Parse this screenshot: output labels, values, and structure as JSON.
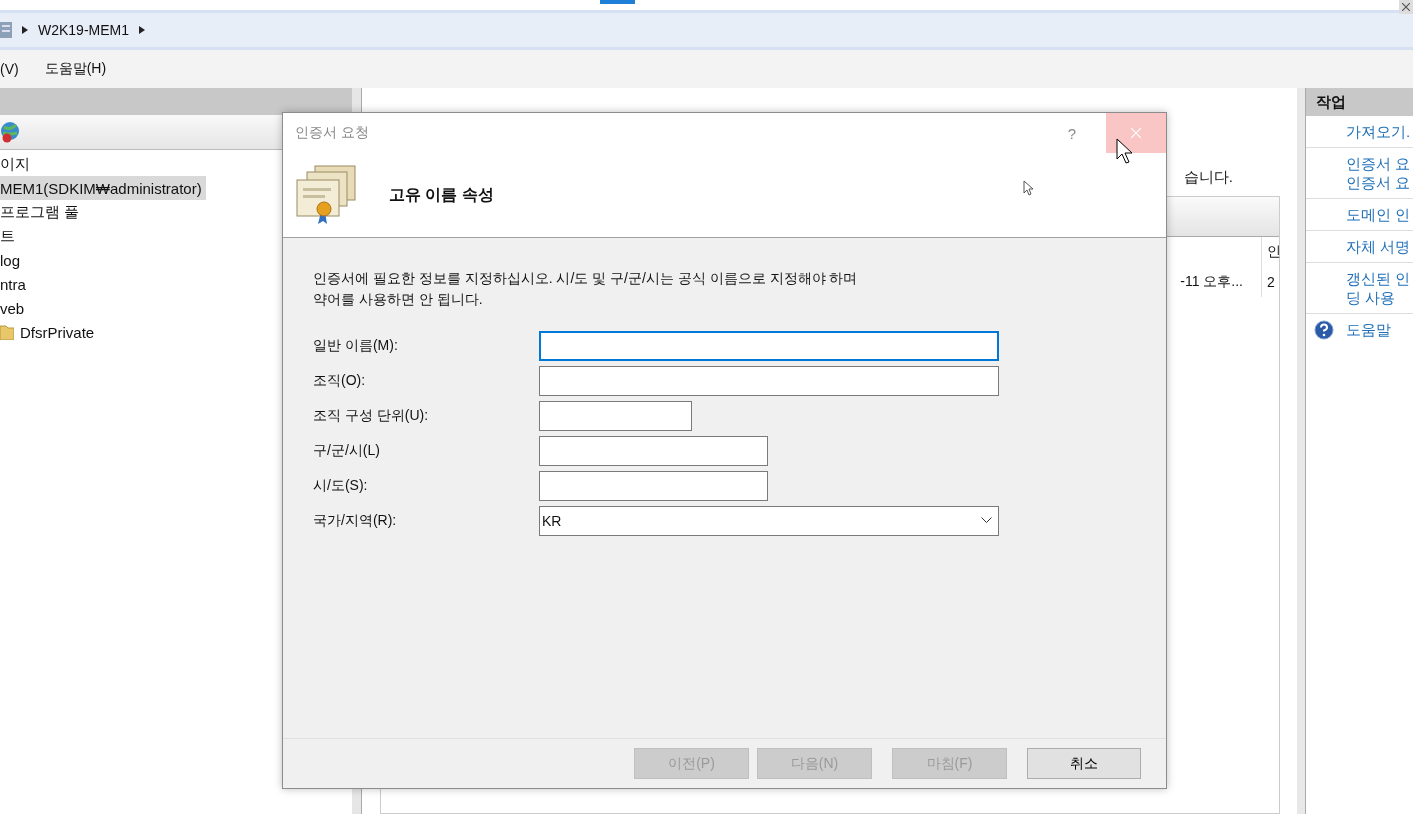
{
  "address_bar": {
    "path": "W2K19-MEM1"
  },
  "menu": [
    "(V)",
    "도움말(H)"
  ],
  "tree": {
    "items": [
      {
        "label": "이지",
        "selected": false,
        "kind": "plain"
      },
      {
        "label": "MEM1(SDKIM₩administrator)",
        "selected": true,
        "kind": "plain"
      },
      {
        "label": "프로그램 풀",
        "selected": false,
        "kind": "plain"
      },
      {
        "label": "트",
        "selected": false,
        "kind": "plain"
      },
      {
        "label": "log",
        "selected": false,
        "kind": "plain"
      },
      {
        "label": "ntra",
        "selected": false,
        "kind": "plain"
      },
      {
        "label": "veb",
        "selected": false,
        "kind": "plain"
      },
      {
        "label": "DfsrPrivate",
        "selected": false,
        "kind": "folder"
      }
    ]
  },
  "center": {
    "description": "습니다.",
    "table": {
      "columns": [
        "",
        "인"
      ],
      "rows": [
        [
          "-11 오후...",
          "2"
        ]
      ]
    }
  },
  "actions": {
    "title": "작업",
    "items": [
      {
        "label": "가져오기.",
        "kind": "link"
      },
      {
        "label": "인증서 요\n인증서 요",
        "kind": "link"
      },
      {
        "label": "도메인 인",
        "kind": "link"
      },
      {
        "label": "자체 서명",
        "kind": "link"
      },
      {
        "label": "갱신된 인\n딩 사용",
        "kind": "link"
      },
      {
        "label": "도움말",
        "kind": "help"
      }
    ]
  },
  "dialog": {
    "title": "인증서 요청",
    "help": "?",
    "heading": "고유 이름 속성",
    "instructions": "인증서에 필요한 정보를 지정하십시오. 시/도 및 구/군/시는 공식 이름으로 지정해야 하며\n약어를 사용하면 안 됩니다.",
    "fields": [
      {
        "label": "일반 이름(M):",
        "kind": "text",
        "focused": true
      },
      {
        "label": "조직(O):",
        "kind": "text",
        "focused": false
      },
      {
        "label": "조직 구성 단위(U):",
        "kind": "text",
        "focused": false
      },
      {
        "label": "구/군/시(L)",
        "kind": "text",
        "focused": false
      },
      {
        "label": "시/도(S):",
        "kind": "text",
        "focused": false
      },
      {
        "label": "국가/지역(R):",
        "kind": "select",
        "value": "KR",
        "focused": false
      }
    ],
    "buttons": [
      {
        "label": "이전(P)",
        "disabled": true
      },
      {
        "label": "다음(N)",
        "disabled": true
      },
      {
        "label": "마침(F)",
        "disabled": true
      },
      {
        "label": "취소",
        "disabled": false
      }
    ]
  }
}
